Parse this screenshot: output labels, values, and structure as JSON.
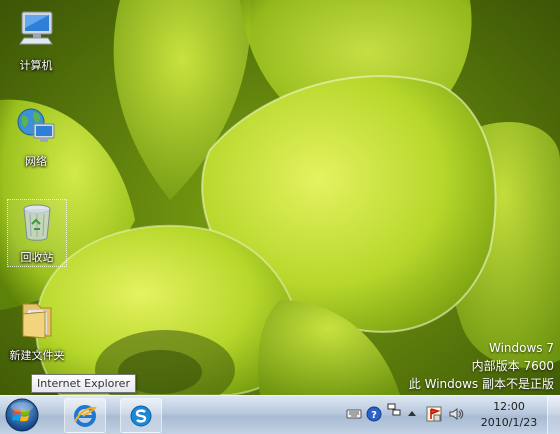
{
  "desktop": {
    "icons": [
      {
        "label": "计算机",
        "icon": "computer-icon"
      },
      {
        "label": "网络",
        "icon": "network-icon"
      },
      {
        "label": "回收站",
        "icon": "recycle-bin-icon"
      },
      {
        "label": "新建文件夹",
        "icon": "folder-icon"
      }
    ]
  },
  "watermark": {
    "line1": "Windows 7",
    "line2": "内部版本 7600",
    "line3": "此 Windows 副本不是正版"
  },
  "tooltip": {
    "text": "Internet Explorer"
  },
  "taskbar": {
    "buttons": [
      {
        "name": "Internet Explorer",
        "icon": "internet-explorer-icon"
      },
      {
        "name": "",
        "icon": "sogou-s-icon"
      }
    ],
    "tray": {
      "icons": [
        "keyboard-icon",
        "help-icon",
        "language-icon",
        "show-hidden-icons-arrow",
        "action-center-flag-icon",
        "volume-icon"
      ]
    },
    "clock": {
      "time": "12:00",
      "date": "2010/1/23"
    }
  },
  "colors": {
    "wallpaper_light": "#d6e84a",
    "wallpaper_mid": "#9cc21e",
    "wallpaper_dark": "#3f5a08",
    "taskbar": "#b7c8dd"
  }
}
